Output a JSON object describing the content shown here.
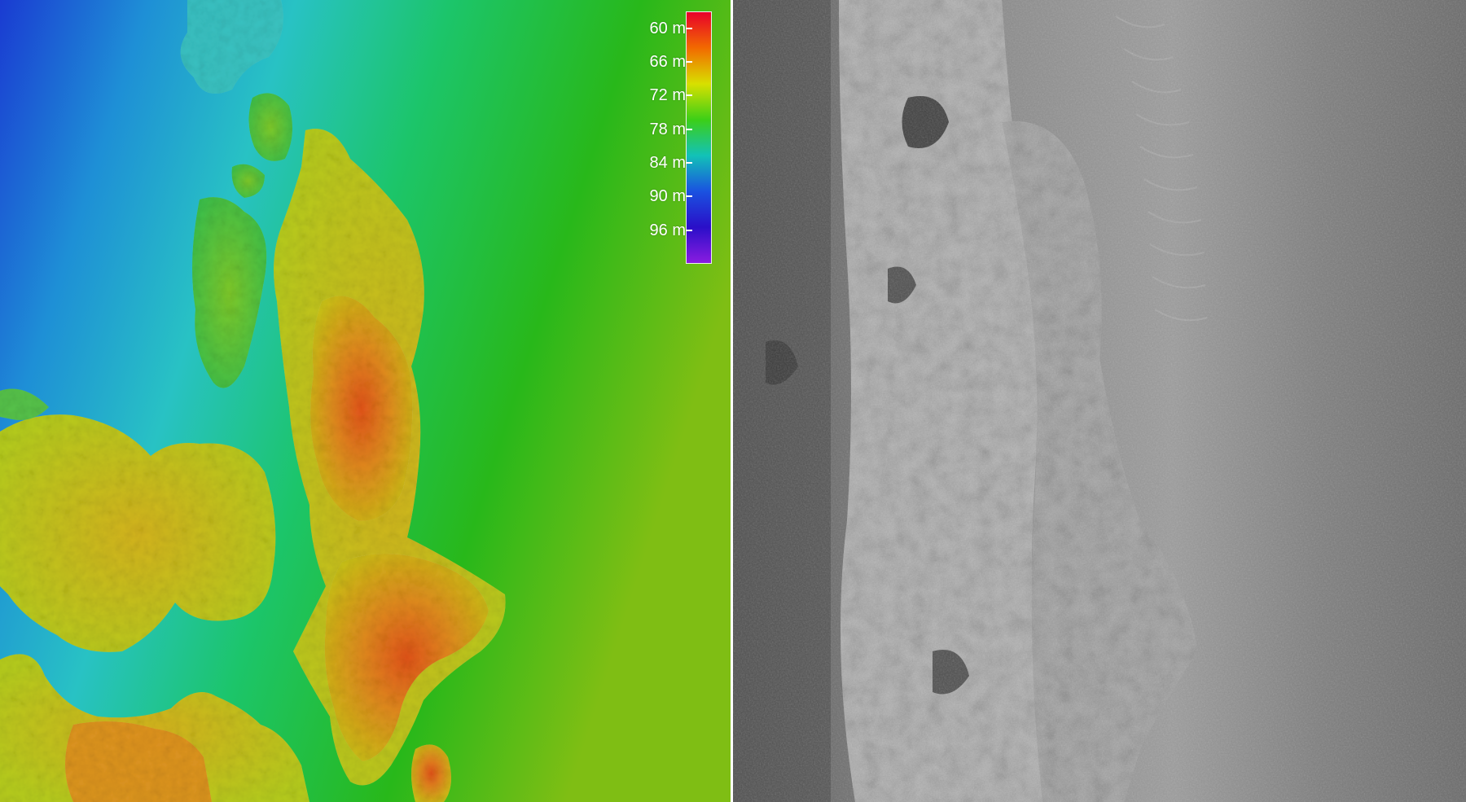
{
  "panels": {
    "bathymetry": {
      "legend": {
        "ticks": [
          "60 m",
          "66 m",
          "72 m",
          "78 m",
          "84 m",
          "90 m",
          "96 m"
        ],
        "tick_values": [
          60,
          66,
          72,
          78,
          84,
          90,
          96
        ],
        "range": [
          57,
          102
        ],
        "colormap": [
          "#e8002a",
          "#f26a00",
          "#d8e000",
          "#3ccf17",
          "#12c2b7",
          "#1a52e0",
          "#2a0fc8",
          "#8a1ce0"
        ]
      }
    },
    "sidescan": {
      "style": "grayscale"
    }
  }
}
